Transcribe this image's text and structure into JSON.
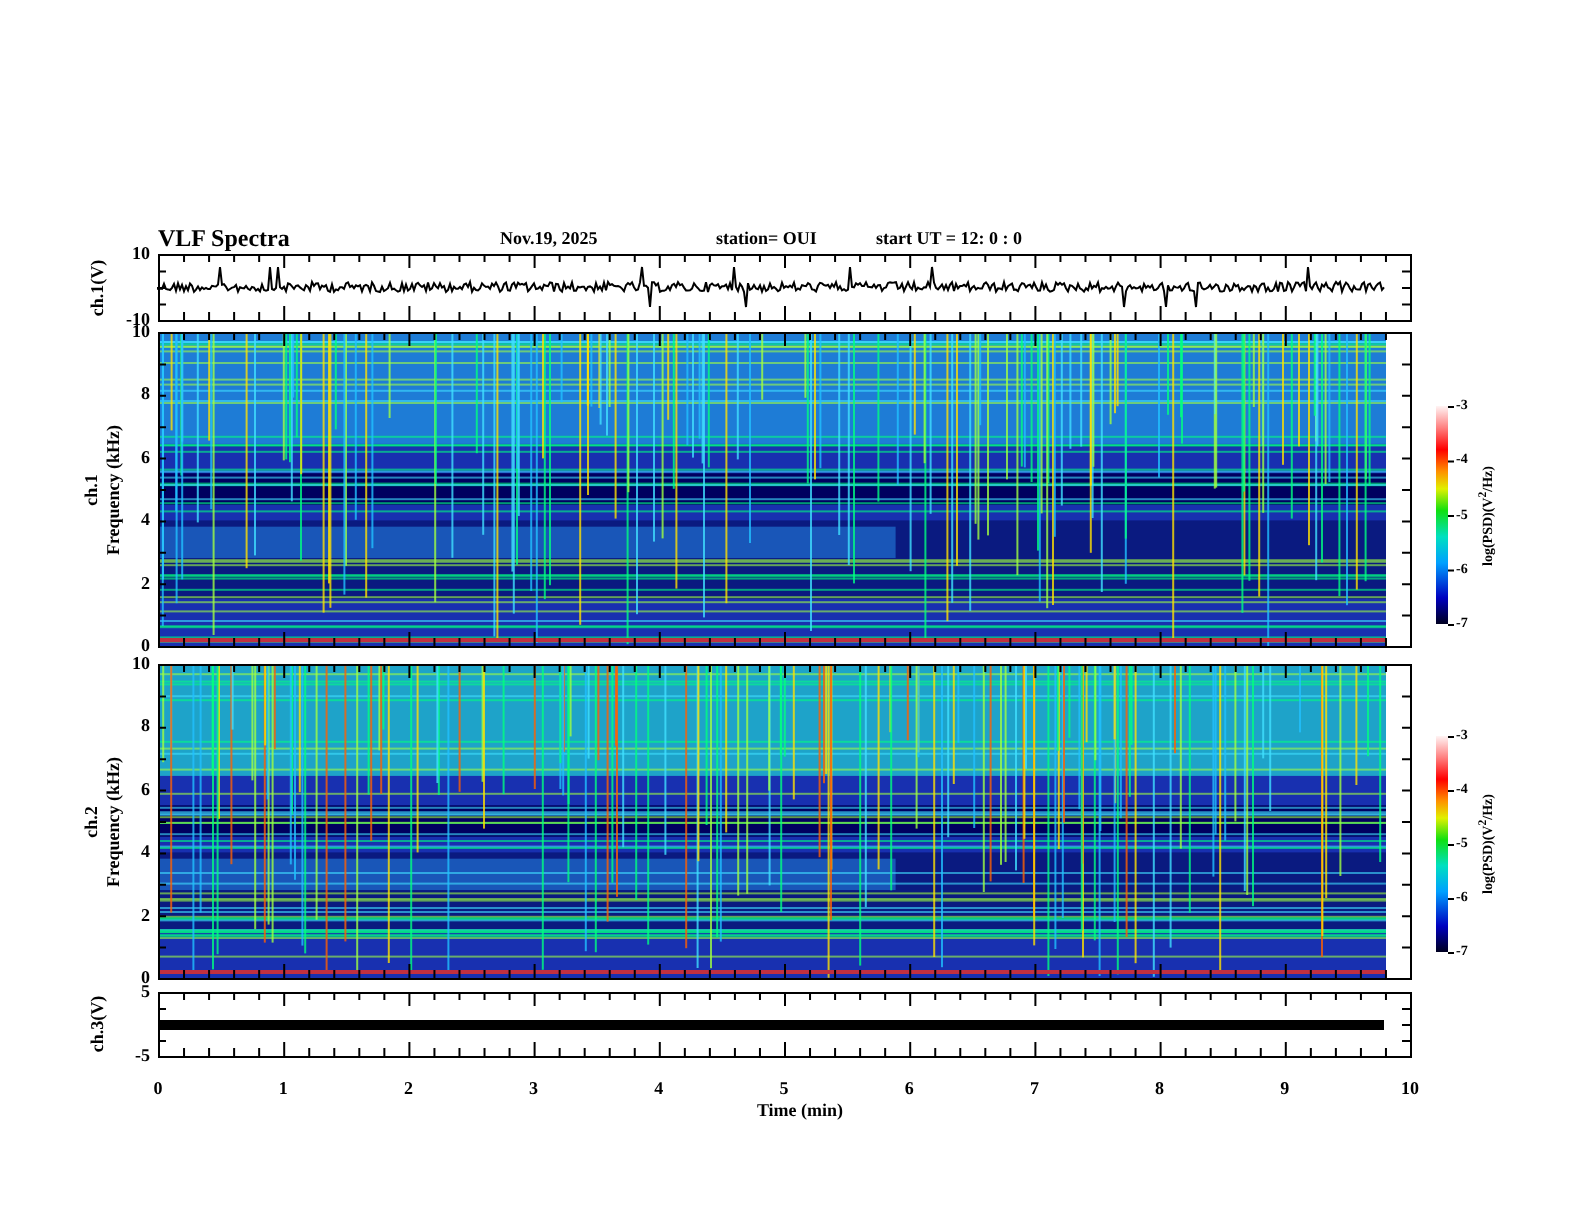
{
  "title": "VLF Spectra",
  "date": "Nov.19, 2025",
  "station": "station= OUI",
  "start_time": "start  UT =   12: 0  : 0",
  "panels": [
    {
      "kind": "waveform",
      "ylabel": "ch.1(V)",
      "yticks": [
        "10",
        "-10"
      ]
    },
    {
      "kind": "spectrogram",
      "channel": "ch.1",
      "ylabel": "Frequency (kHz)",
      "yticks": [
        "10",
        "8",
        "6",
        "4",
        "2",
        "0"
      ],
      "colorbar": {
        "ticks": [
          "-3",
          "-4",
          "-5",
          "-6",
          "-7"
        ],
        "label": "log(PSD)(V$^{2}$/Hz)"
      }
    },
    {
      "kind": "spectrogram",
      "channel": "ch.2",
      "ylabel": "Frequency (kHz)",
      "yticks": [
        "10",
        "8",
        "6",
        "4",
        "2",
        "0"
      ],
      "colorbar": {
        "ticks": [
          "-3",
          "-4",
          "-5",
          "-6",
          "-7"
        ],
        "label": "log(PSD)(V$^{2}$/Hz)"
      }
    },
    {
      "kind": "flatline",
      "ylabel": "ch.3(V)",
      "yticks": [
        "5",
        "-5"
      ]
    }
  ],
  "x_axis": {
    "ticks": [
      "0",
      "1",
      "2",
      "3",
      "4",
      "5",
      "6",
      "7",
      "8",
      "9",
      "10"
    ],
    "label": "Time (min)"
  }
}
